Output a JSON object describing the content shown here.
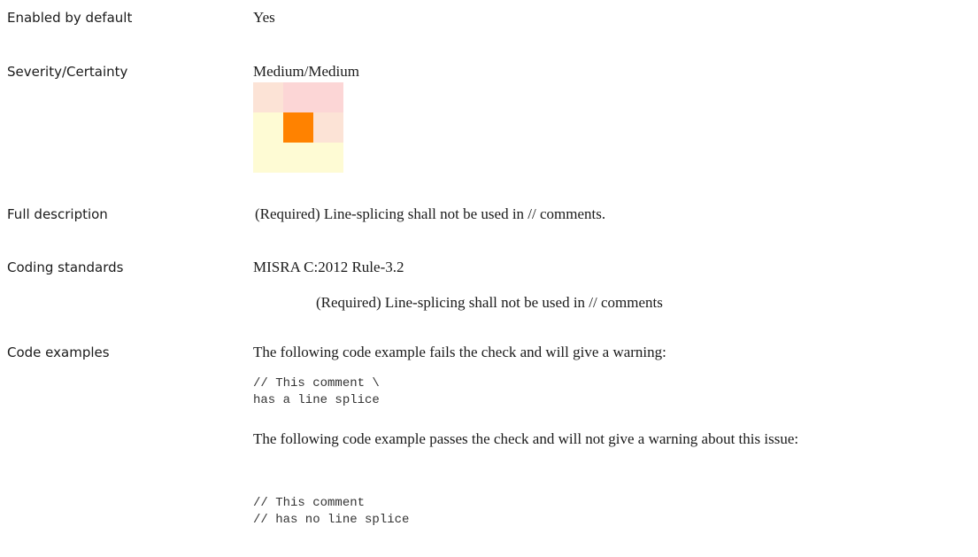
{
  "rows": {
    "enabled": {
      "label": "Enabled by default",
      "value": "Yes"
    },
    "severity": {
      "label": "Severity/Certainty",
      "value": "Medium/Medium",
      "matrix_colors": [
        [
          "#fce3d6",
          "#fcd6d6",
          "#fcd6d6"
        ],
        [
          "#fefbd4",
          "#ff8200",
          "#fce3d6"
        ],
        [
          "#fefbd4",
          "#fefbd4",
          "#fefbd4"
        ]
      ]
    },
    "full_description": {
      "label": "Full description",
      "value": "(Required) Line-splicing shall not be used in // comments."
    },
    "coding_standards": {
      "label": "Coding standards",
      "standard": "MISRA C:2012 Rule-3.2",
      "standard_text": "(Required) Line-splicing shall not be used in // comments"
    },
    "code_examples": {
      "label": "Code examples",
      "fail_intro": "The following code example fails the check and will give a warning:",
      "fail_code": "// This comment \\\nhas a line splice",
      "pass_intro": "The following code example passes the check and will not give a warning about this issue:",
      "pass_code": "// This comment\n// has no line splice"
    }
  }
}
